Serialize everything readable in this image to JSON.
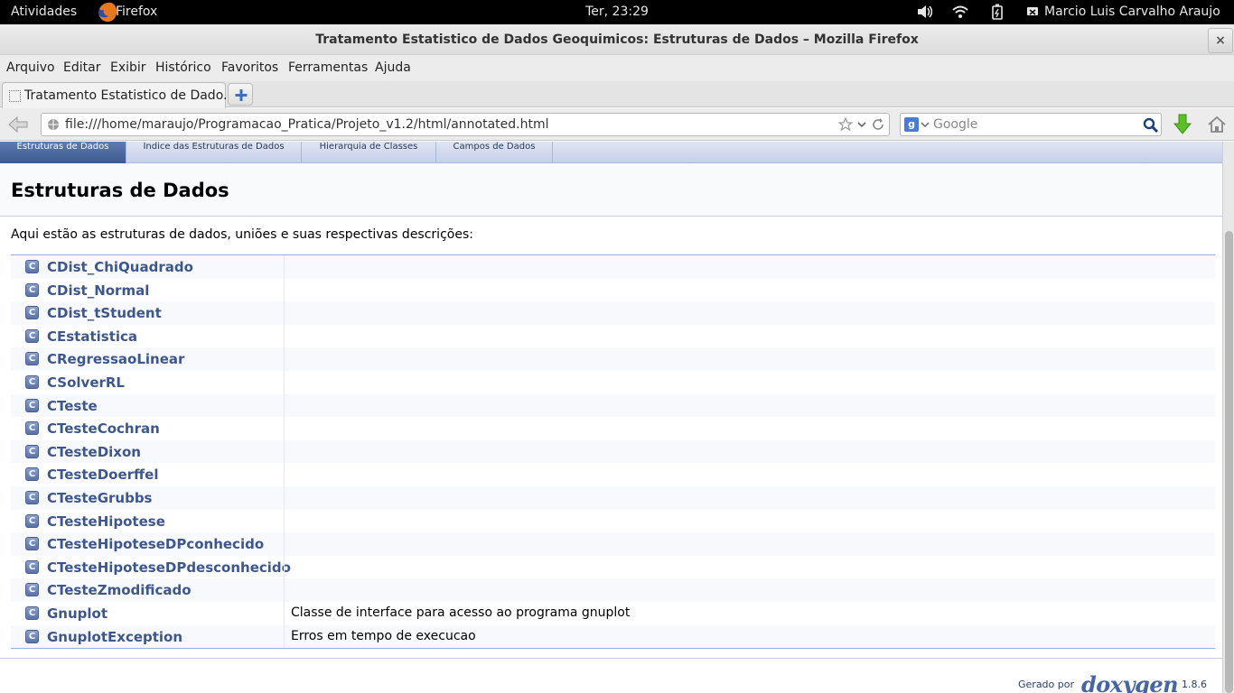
{
  "topbar": {
    "activities": "Atividades",
    "app_name": "Firefox",
    "clock": "Ter, 23:29",
    "user_name": "Marcio Luis Carvalho Araujo"
  },
  "window": {
    "title": "Tratamento Estatistico de Dados Geoquimicos: Estruturas de Dados – Mozilla Firefox",
    "close_glyph": "×"
  },
  "menu": {
    "arquivo": "Arquivo",
    "editar": "Editar",
    "exibir": "Exibir",
    "historico": "Histórico",
    "favoritos": "Favoritos",
    "ferramentas": "Ferramentas",
    "ajuda": "Ajuda"
  },
  "tab": {
    "label": "Tratamento Estatistico de Dado..."
  },
  "nav": {
    "url": "file:///home/maraujo/Programacao_Pratica/Projeto_v1.2/html/annotated.html",
    "search_placeholder": "Google",
    "search_engine_glyph": "g"
  },
  "doxygen_tabs": [
    {
      "label": "Estruturas de Dados"
    },
    {
      "label": "Índice das Estruturas de Dados"
    },
    {
      "label": "Hierarquia de Classes"
    },
    {
      "label": "Campos de Dados"
    }
  ],
  "page": {
    "title": "Estruturas de Dados",
    "intro": "Aqui estão as estruturas de dados, uniões e suas respectivas descrições:",
    "class_icon_letter": "C",
    "classes": [
      {
        "name": "CDist_ChiQuadrado",
        "desc": ""
      },
      {
        "name": "CDist_Normal",
        "desc": ""
      },
      {
        "name": "CDist_tStudent",
        "desc": ""
      },
      {
        "name": "CEstatistica",
        "desc": ""
      },
      {
        "name": "CRegressaoLinear",
        "desc": ""
      },
      {
        "name": "CSolverRL",
        "desc": ""
      },
      {
        "name": "CTeste",
        "desc": ""
      },
      {
        "name": "CTesteCochran",
        "desc": ""
      },
      {
        "name": "CTesteDixon",
        "desc": ""
      },
      {
        "name": "CTesteDoerffel",
        "desc": ""
      },
      {
        "name": "CTesteGrubbs",
        "desc": ""
      },
      {
        "name": "CTesteHipotese",
        "desc": ""
      },
      {
        "name": "CTesteHipoteseDPconhecido",
        "desc": ""
      },
      {
        "name": "CTesteHipoteseDPdesconhecido",
        "desc": ""
      },
      {
        "name": "CTesteZmodificado",
        "desc": ""
      },
      {
        "name": "Gnuplot",
        "desc": "Classe de interface para acesso ao programa gnuplot"
      },
      {
        "name": "GnuplotException",
        "desc": "Erros em tempo de execucao"
      }
    ]
  },
  "footer": {
    "generated_by": "Gerado por",
    "logo_text": "doxygen",
    "version": "1.8.6"
  },
  "colors": {
    "link": "#3d578c",
    "active_tab": "#3d5a8e",
    "topbar_bg": "#000000"
  }
}
